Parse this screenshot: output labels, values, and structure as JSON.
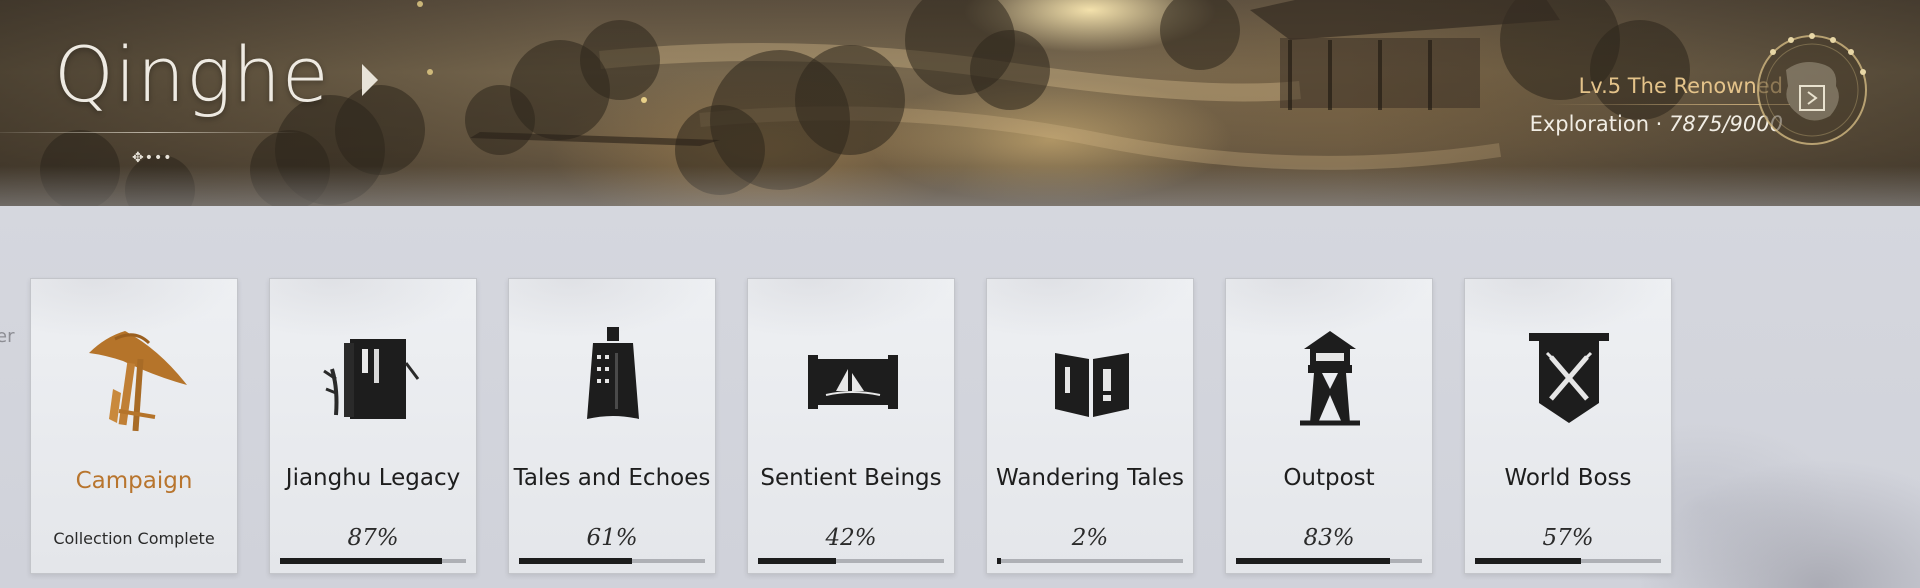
{
  "banner": {
    "region_name": "Qinghe",
    "rank": "Lv.5 The Renowned",
    "exploration_label": "Exploration · ",
    "exploration_value": "7875/9000",
    "dots": "✥•••"
  },
  "edge_text": "er",
  "colors": {
    "gold_text": "#b8752e",
    "rank_text": "#e4c38a",
    "progress_fill": "#1c1c1c",
    "progress_track": "#aeb0b5"
  },
  "cards": [
    {
      "label": "Campaign",
      "subtitle": "Collection Complete",
      "icon": "straw-hat-icon"
    },
    {
      "label": "Jianghu Legacy",
      "percent_text": "87%",
      "progress": 0.87,
      "icon": "book-icon"
    },
    {
      "label": "Tales and Echoes",
      "percent_text": "61%",
      "progress": 0.61,
      "icon": "bell-icon"
    },
    {
      "label": "Sentient Beings",
      "percent_text": "42%",
      "progress": 0.42,
      "icon": "scroll-painting-icon"
    },
    {
      "label": "Wandering Tales",
      "percent_text": "2%",
      "progress": 0.02,
      "icon": "open-book-icon"
    },
    {
      "label": "Outpost",
      "percent_text": "83%",
      "progress": 0.83,
      "icon": "watchtower-icon"
    },
    {
      "label": "World Boss",
      "percent_text": "57%",
      "progress": 0.57,
      "icon": "crossed-swords-banner-icon"
    }
  ]
}
